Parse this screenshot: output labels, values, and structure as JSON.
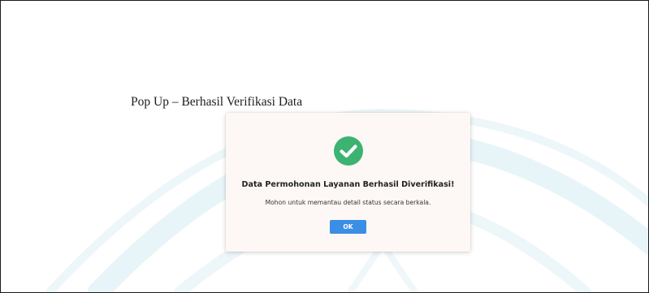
{
  "caption": "Pop Up – Berhasil Verifikasi Data",
  "popup": {
    "icon": "check-circle-icon",
    "title": "Data Permohonan Layanan Berhasil Diverifikasi!",
    "message": "Mohon untuk memantau detail status secara berkala.",
    "ok_label": "OK"
  },
  "colors": {
    "success": "#3cb371",
    "button": "#3a8ee6",
    "watermark": "#d6ecf2",
    "popup_bg": "#fdf8f5"
  }
}
